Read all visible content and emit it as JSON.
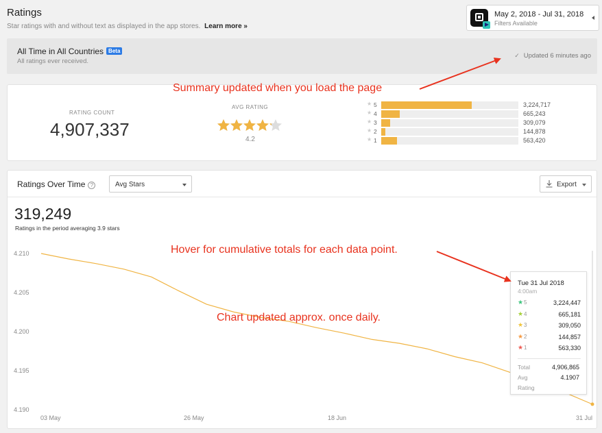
{
  "header": {
    "title": "Ratings",
    "subtitle": "Star ratings with and without text as displayed in the app stores.",
    "learn_more": "Learn more »"
  },
  "date_filter": {
    "range": "May 2, 2018 - Jul 31, 2018",
    "filters": "Filters Available"
  },
  "banner": {
    "title": "All Time in All Countries",
    "badge": "Beta",
    "subtitle": "All ratings ever received.",
    "updated": "Updated 6 minutes ago"
  },
  "summary": {
    "rating_count_label": "RATING COUNT",
    "rating_count": "4,907,337",
    "avg_rating_label": "AVG RATING",
    "avg_rating": "4.2",
    "avg_rating_value": 4.2,
    "distribution": [
      {
        "star": "5",
        "count": "3,224,717",
        "value": 3224717
      },
      {
        "star": "4",
        "count": "665,243",
        "value": 665243
      },
      {
        "star": "3",
        "count": "309,079",
        "value": 309079
      },
      {
        "star": "2",
        "count": "144,878",
        "value": 144878
      },
      {
        "star": "1",
        "count": "563,420",
        "value": 563420
      }
    ]
  },
  "ratings_over_time": {
    "title": "Ratings Over Time",
    "help": "?",
    "metric_select": "Avg Stars",
    "export_label": "Export",
    "big_number": "319,249",
    "big_subtitle": "Ratings in the period averaging 3.9 stars"
  },
  "chart_data": {
    "type": "line",
    "yticks": [
      "4.210",
      "4.205",
      "4.200",
      "4.195",
      "4.190"
    ],
    "ylim": [
      4.19,
      4.21
    ],
    "xticks": [
      "03 May",
      "26 May",
      "18 Jun",
      "31 Jul"
    ],
    "series": [
      {
        "values": [
          [
            0,
            4.21
          ],
          [
            5,
            4.2093
          ],
          [
            10,
            4.2087
          ],
          [
            15,
            4.208
          ],
          [
            20,
            4.207
          ],
          [
            25,
            4.2052
          ],
          [
            30,
            4.2035
          ],
          [
            35,
            4.2025
          ],
          [
            40,
            4.2018
          ],
          [
            45,
            4.2013
          ],
          [
            50,
            4.2005
          ],
          [
            55,
            4.1998
          ],
          [
            60,
            4.199
          ],
          [
            65,
            4.1985
          ],
          [
            70,
            4.1978
          ],
          [
            75,
            4.1968
          ],
          [
            80,
            4.196
          ],
          [
            85,
            4.1948
          ],
          [
            90,
            4.1937
          ],
          [
            95,
            4.1922
          ],
          [
            100,
            4.1907
          ]
        ],
        "color": "#f0b443"
      }
    ],
    "x_domain": [
      0,
      100
    ]
  },
  "tooltip": {
    "date": "Tue 31 Jul 2018",
    "time": "4:00am",
    "rows": [
      {
        "star": "5",
        "value": "3,224,447",
        "color": "#3cc47c"
      },
      {
        "star": "4",
        "value": "665,181",
        "color": "#a6d13a"
      },
      {
        "star": "3",
        "value": "309,050",
        "color": "#f0c43a"
      },
      {
        "star": "2",
        "value": "144,857",
        "color": "#f59a42"
      },
      {
        "star": "1",
        "value": "563,330",
        "color": "#ee5a52"
      }
    ],
    "total_label": "Total",
    "total_value": "4,906,865",
    "avg_label": "Avg",
    "avg_value": "4.1907",
    "rating_label": "Rating"
  },
  "annotations": {
    "summary_note": "Summary updated when you load the page",
    "hover_note": "Hover for cumulative totals for each data point.",
    "chart_note": "Chart updated approx. once daily."
  },
  "colors": {
    "accent_bar": "#f0b443",
    "annotation": "#e8321e",
    "beta_badge": "#2c7be5"
  }
}
